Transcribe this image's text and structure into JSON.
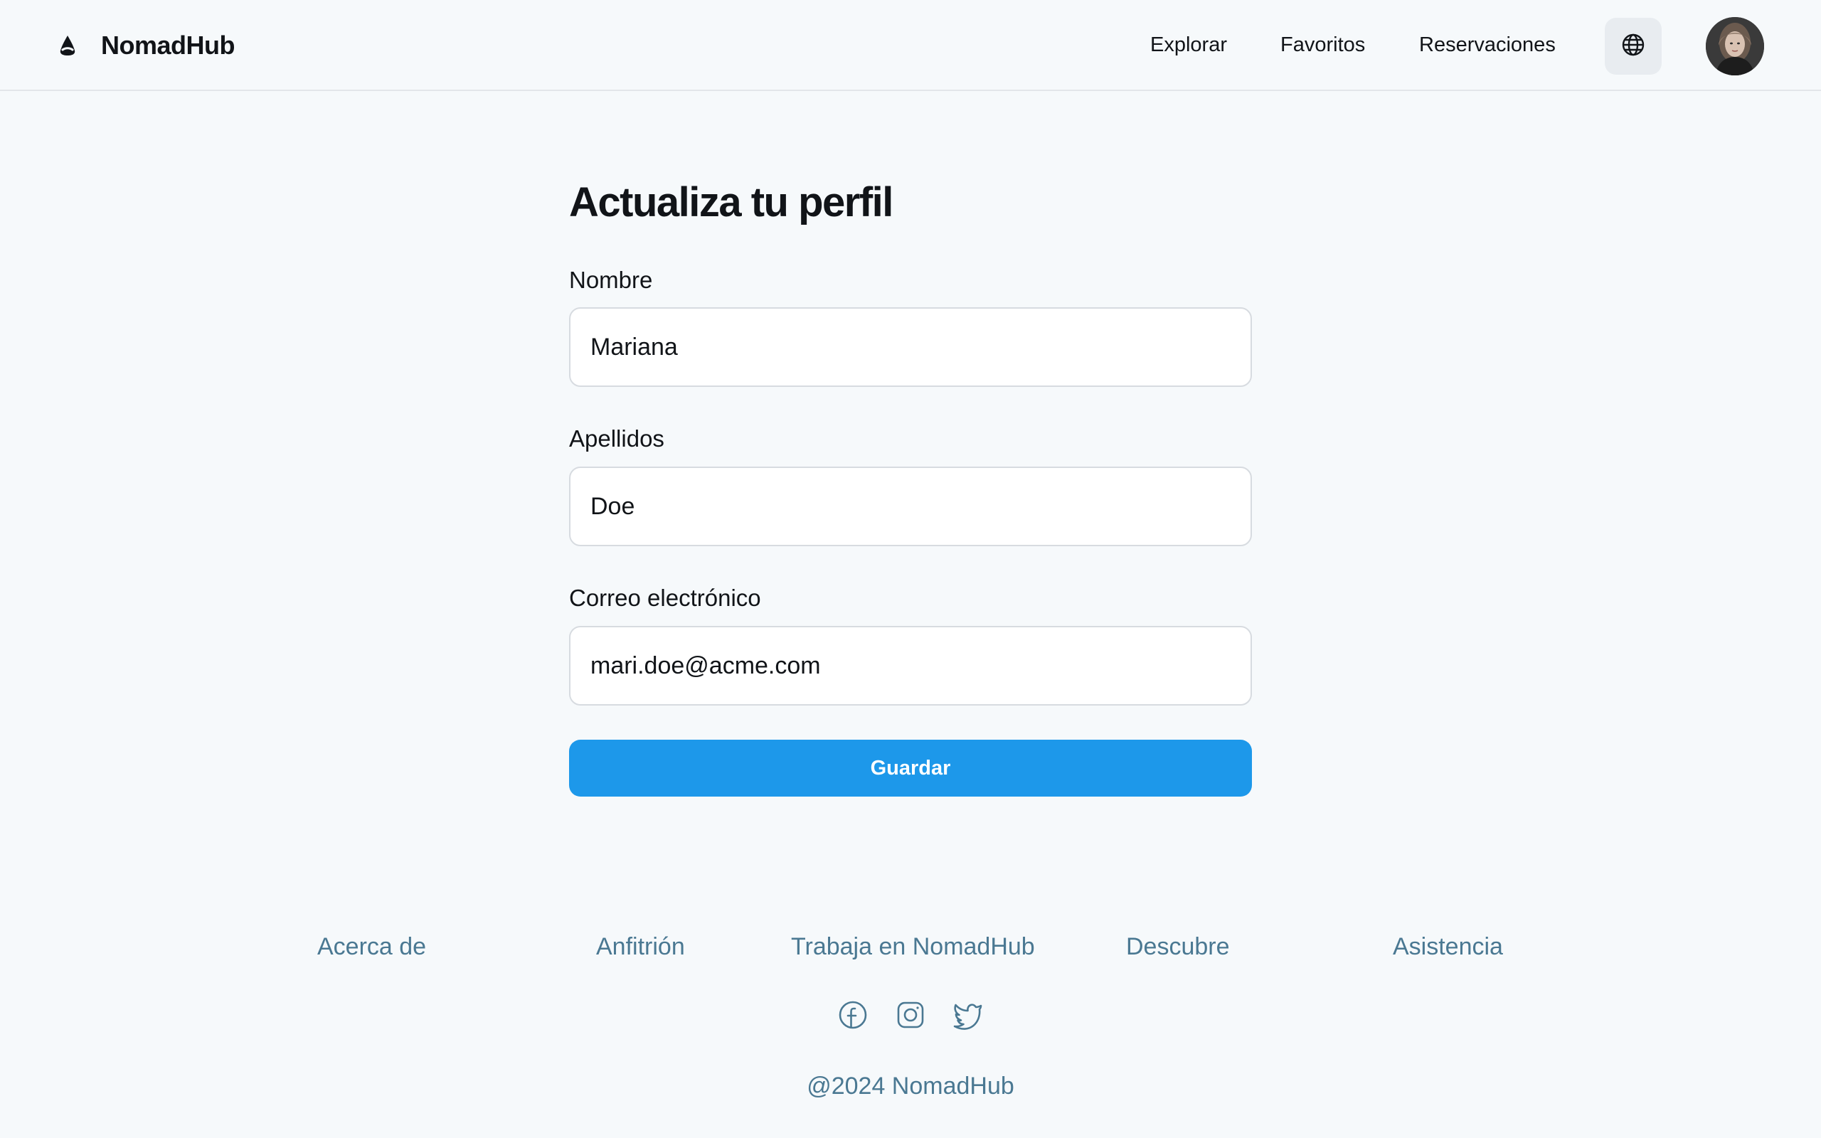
{
  "header": {
    "brand": "NomadHub",
    "nav": [
      {
        "label": "Explorar"
      },
      {
        "label": "Favoritos"
      },
      {
        "label": "Reservaciones"
      }
    ],
    "language_icon": "globe-icon",
    "avatar_icon": "user-avatar"
  },
  "form": {
    "title": "Actualiza tu perfil",
    "fields": [
      {
        "label": "Nombre",
        "value": "Mariana"
      },
      {
        "label": "Apellidos",
        "value": "Doe"
      },
      {
        "label": "Correo electrónico",
        "value": "mari.doe@acme.com"
      }
    ],
    "submit_label": "Guardar"
  },
  "footer": {
    "links": [
      {
        "label": "Acerca de"
      },
      {
        "label": "Anfitrión"
      },
      {
        "label": "Trabaja en NomadHub"
      },
      {
        "label": "Descubre"
      },
      {
        "label": "Asistencia"
      }
    ],
    "social": [
      {
        "icon": "facebook-icon"
      },
      {
        "icon": "instagram-icon"
      },
      {
        "icon": "twitter-icon"
      }
    ],
    "copyright": "@2024 NomadHub"
  },
  "colors": {
    "background": "#f6f9fb",
    "primary": "#1d98ea",
    "footer_text": "#4a7892",
    "text": "#111418"
  }
}
